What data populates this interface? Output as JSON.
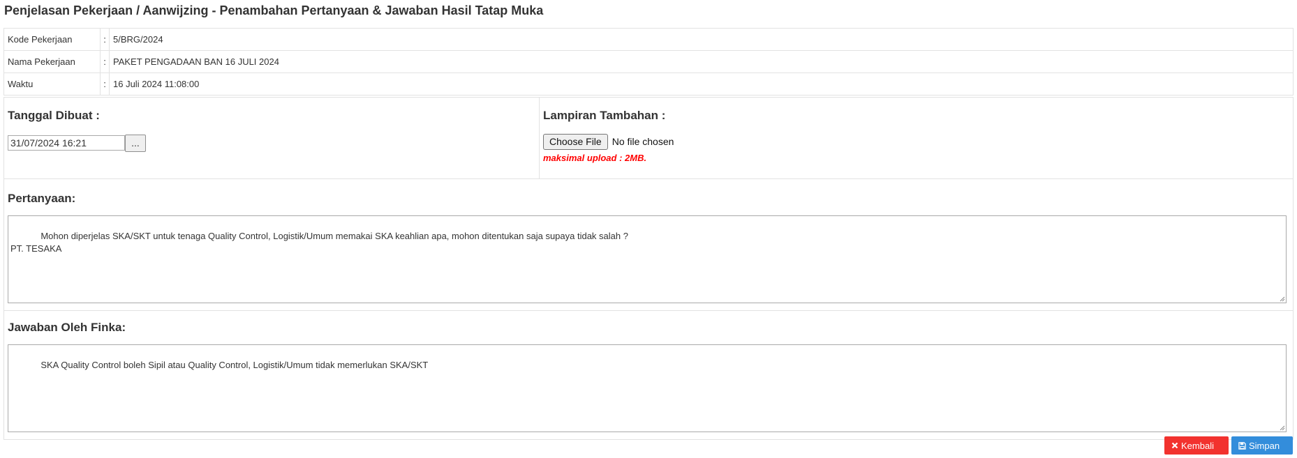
{
  "page_title": "Penjelasan Pekerjaan / Aanwijzing - Penambahan Pertanyaan & Jawaban Hasil Tatap Muka",
  "info": {
    "separator": ":",
    "rows": [
      {
        "label": "Kode Pekerjaan",
        "value": "5/BRG/2024"
      },
      {
        "label": "Nama Pekerjaan",
        "value": "PAKET PENGADAAN BAN 16 JULI 2024"
      },
      {
        "label": "Waktu",
        "value": "16 Juli 2024 11:08:00"
      }
    ]
  },
  "form": {
    "tanggal": {
      "label": "Tanggal Dibuat :",
      "value": "31/07/2024 16:21",
      "picker_label": "..."
    },
    "lampiran": {
      "label": "Lampiran Tambahan :",
      "choose_label": "Choose File",
      "status": "No file chosen",
      "note": "maksimal upload : 2MB."
    },
    "pertanyaan": {
      "label": "Pertanyaan:",
      "value": "Mohon diperjelas SKA/SKT untuk tenaga Quality Control, Logistik/Umum memakai SKA keahlian apa, mohon ditentukan saja supaya tidak salah ?\nPT. TESAKA"
    },
    "jawaban": {
      "label": "Jawaban Oleh Finka:",
      "value": "SKA Quality Control boleh Sipil atau Quality Control, Logistik/Umum tidak memerlukan SKA/SKT"
    }
  },
  "buttons": {
    "back_label": "Kembali",
    "save_label": "Simpan",
    "back_icon": "times-icon",
    "save_icon": "floppy-disk-icon"
  },
  "colors": {
    "back": "#f2322e",
    "save": "#338ddb",
    "note": "#ff0000"
  }
}
